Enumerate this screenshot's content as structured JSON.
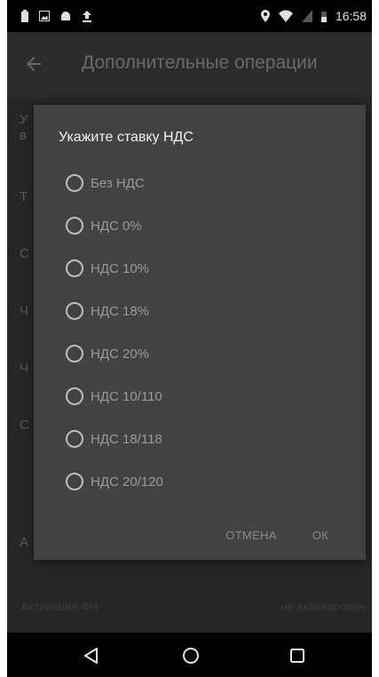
{
  "status_bar": {
    "time": "16:58"
  },
  "app_bar": {
    "title": "Дополнительные операции"
  },
  "background_rows": {
    "letters": [
      "У",
      "в",
      "Т",
      "С",
      "Ч",
      "Ч",
      "С",
      "А"
    ],
    "bottom_left": "Активация ФН",
    "bottom_right": "не активирован"
  },
  "dialog": {
    "title": "Укажите ставку НДС",
    "options": [
      {
        "label": "Без НДС"
      },
      {
        "label": "НДС 0%"
      },
      {
        "label": "НДС 10%"
      },
      {
        "label": "НДС 18%"
      },
      {
        "label": "НДС 20%"
      },
      {
        "label": "НДС 10/110"
      },
      {
        "label": "НДС 18/118"
      },
      {
        "label": "НДС 20/120"
      }
    ],
    "cancel_label": "ОТМЕНА",
    "ok_label": "ОК"
  },
  "nav_bar": {
    "icons": [
      "back-triangle-icon",
      "home-circle-icon",
      "recents-square-icon"
    ]
  }
}
